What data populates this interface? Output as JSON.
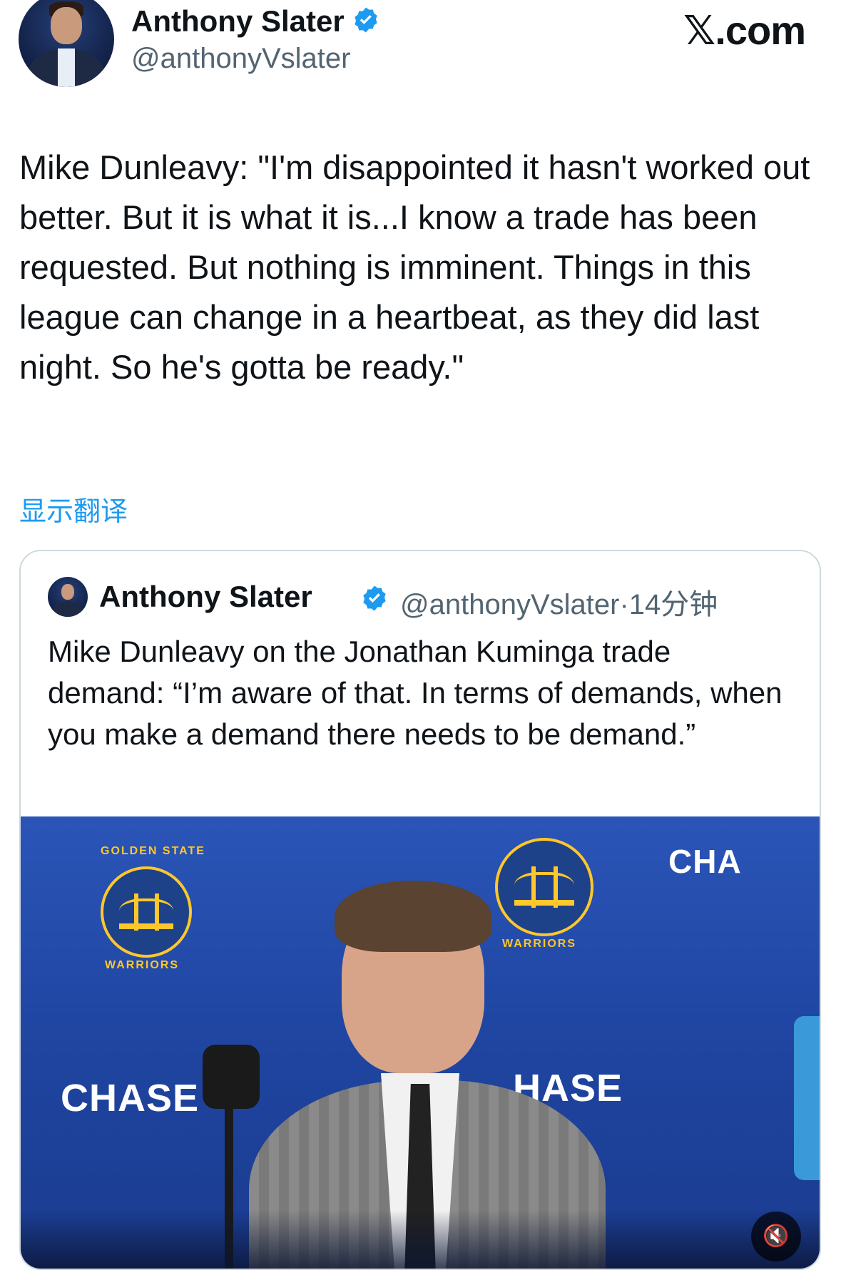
{
  "author": {
    "name": "Anthony Slater",
    "handle": "@anthonyVslater"
  },
  "site_label": "𝕏.com",
  "tweet": {
    "text": "Mike Dunleavy: \"I'm disappointed it hasn't worked out better. But it is what it is...I know a trade has been requested. But nothing is imminent. Things in this league can change in a heartbeat, as they did last night. So he's gotta be ready.\"",
    "translate_label": "显示翻译"
  },
  "quoted": {
    "name": "Anthony Slater",
    "handle": "@anthonyVslater",
    "separator": "·",
    "time": "14分钟",
    "text": "Mike Dunleavy on the Jonathan Kuminga trade demand: “I’m aware of that. In terms of demands, when you make a demand there needs to be demand.”"
  },
  "video": {
    "sponsor_left": "CHASE",
    "sponsor_right": "HASE",
    "sponsor_top_right": "CHA",
    "logo_top": "GOLDEN STATE",
    "logo_bottom": "WARRIORS",
    "mute_icon": "🔇"
  },
  "colors": {
    "link": "#1d9bf0",
    "verified": "#1d9bf0",
    "muted_text": "#536471",
    "warriors_blue": "#1d428a",
    "warriors_gold": "#ffc72c"
  }
}
